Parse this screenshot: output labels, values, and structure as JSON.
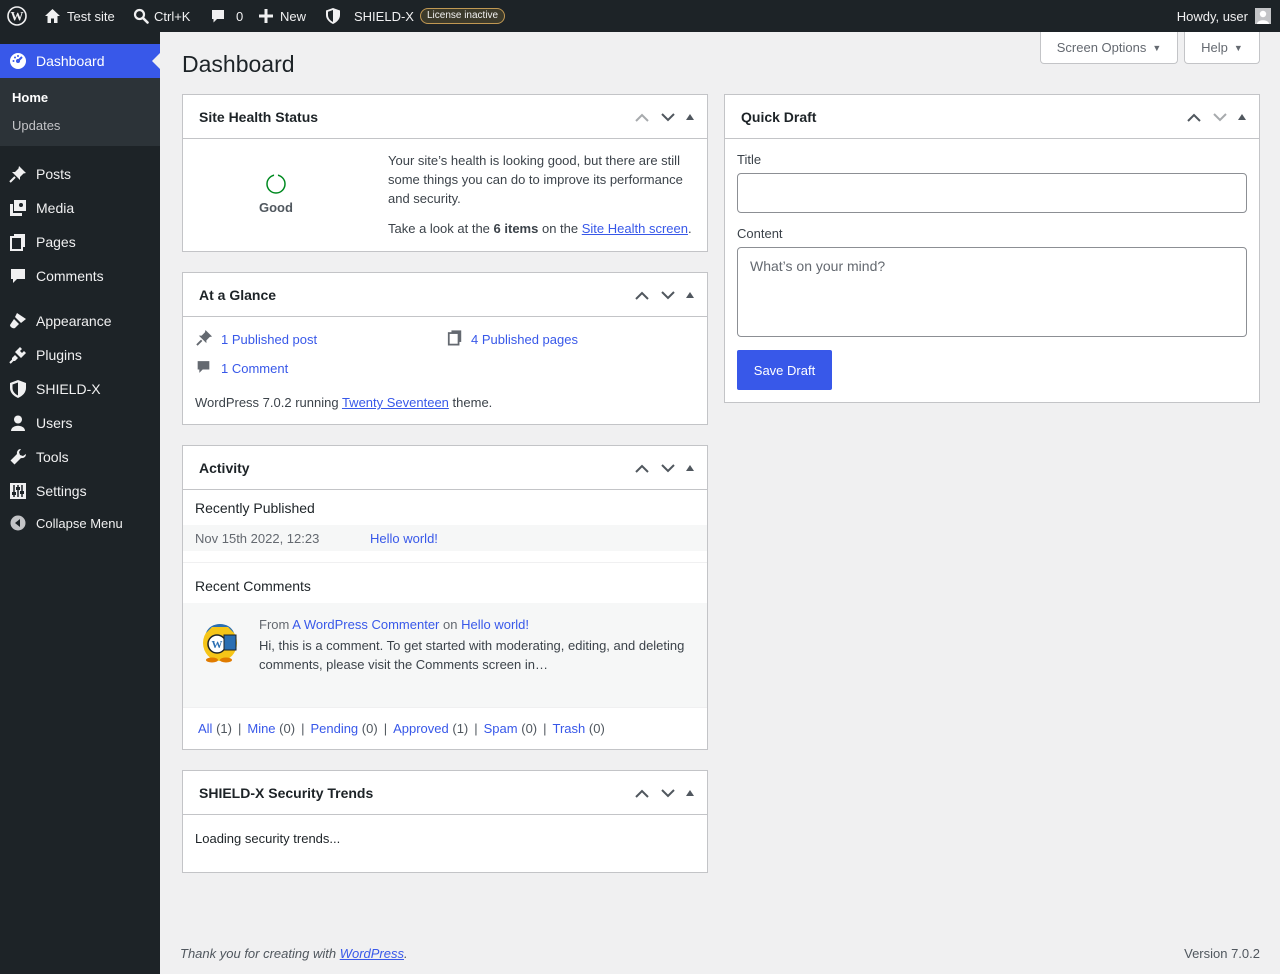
{
  "admin_bar": {
    "site_name": "Test site",
    "command_palette": "Ctrl+K",
    "comments_count": "0",
    "new_label": "New",
    "shield_label": "SHIELD-X",
    "license_badge": "License inactive",
    "howdy": "Howdy, user"
  },
  "sidebar": {
    "dashboard": "Dashboard",
    "submenu": {
      "home": "Home",
      "updates": "Updates"
    },
    "items": {
      "posts": "Posts",
      "media": "Media",
      "pages": "Pages",
      "comments": "Comments",
      "appearance": "Appearance",
      "plugins": "Plugins",
      "shield": "SHIELD-X",
      "users": "Users",
      "tools": "Tools",
      "settings": "Settings",
      "collapse": "Collapse Menu"
    }
  },
  "header": {
    "title": "Dashboard",
    "screen_options": "Screen Options",
    "help": "Help"
  },
  "site_health": {
    "title": "Site Health Status",
    "status": "Good",
    "message": "Your site’s health is looking good, but there are still some things you can do to improve its performance and security.",
    "items_prefix": "Take a look at the",
    "items_count": "6 items",
    "items_mid": "on the",
    "items_link": "Site Health screen",
    "items_suffix": "."
  },
  "at_a_glance": {
    "title": "At a Glance",
    "posts": "1 Published post",
    "pages": "4 Published pages",
    "comments": "1 Comment",
    "running_prefix": "WordPress 7.0.2 running",
    "theme": "Twenty Seventeen",
    "running_suffix": "theme."
  },
  "activity": {
    "title": "Activity",
    "recently_published": "Recently Published",
    "published": {
      "date": "Nov 15th 2022, 12:23",
      "post": "Hello world!"
    },
    "recent_comments": "Recent Comments",
    "comment": {
      "from": "From",
      "author": "A WordPress Commenter",
      "on": "on",
      "post": "Hello world!",
      "excerpt": "Hi, this is a comment. To get started with moderating, editing, and deleting comments, please visit the Comments screen in…"
    },
    "filters": [
      {
        "label": "All",
        "count": "(1)"
      },
      {
        "label": "Mine",
        "count": "(0)"
      },
      {
        "label": "Pending",
        "count": "(0)"
      },
      {
        "label": "Approved",
        "count": "(1)"
      },
      {
        "label": "Spam",
        "count": "(0)"
      },
      {
        "label": "Trash",
        "count": "(0)"
      }
    ]
  },
  "security_trends": {
    "title": "SHIELD-X Security Trends",
    "loading": "Loading security trends..."
  },
  "quick_draft": {
    "title": "Quick Draft",
    "title_label": "Title",
    "title_value": "",
    "content_label": "Content",
    "content_placeholder": "What’s on your mind?",
    "save": "Save Draft"
  },
  "footer": {
    "thanks_prefix": "Thank you for creating with",
    "wordpress": "WordPress",
    "thanks_suffix": ".",
    "version": "Version 7.0.2"
  },
  "colors": {
    "admin_bg": "#1d2327",
    "accent": "#3858e9",
    "health_good": "#008a20"
  }
}
